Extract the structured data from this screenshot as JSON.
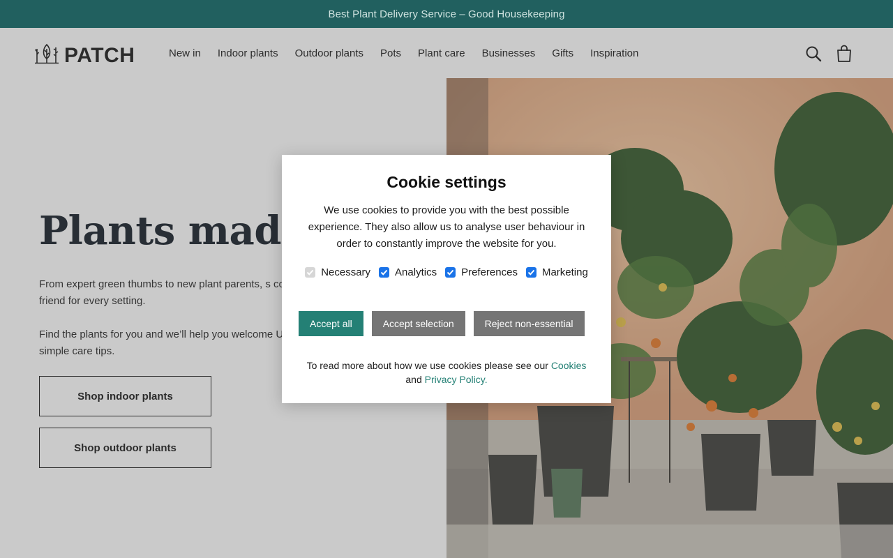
{
  "promo": {
    "text": "Best Plant Delivery Service – Good Housekeeping"
  },
  "brand": {
    "name": "PATCH"
  },
  "nav": [
    {
      "label": "New in"
    },
    {
      "label": "Indoor plants"
    },
    {
      "label": "Outdoor plants"
    },
    {
      "label": "Pots"
    },
    {
      "label": "Plant care"
    },
    {
      "label": "Businesses"
    },
    {
      "label": "Gifts"
    },
    {
      "label": "Inspiration"
    }
  ],
  "header_icons": [
    "search-icon",
    "bag-icon"
  ],
  "hero": {
    "title": "Plants made e",
    "p1": "From expert green thumbs to new plant parents, s corners, we have a leafy friend for every setting.",
    "p2": "Find the plants for you and we’ll help you welcome UK-wide delivery and simple care tips.",
    "btn_indoor": "Shop indoor plants",
    "btn_outdoor": "Shop outdoor plants"
  },
  "cookie": {
    "title": "Cookie settings",
    "text": "We use cookies to provide you with the best possible experience. They also allow us to analyse user behaviour in order to constantly improve the website for you.",
    "options": [
      {
        "label": "Necessary",
        "checked": true,
        "disabled": true
      },
      {
        "label": "Analytics",
        "checked": true
      },
      {
        "label": "Preferences",
        "checked": true
      },
      {
        "label": "Marketing",
        "checked": true
      }
    ],
    "accept_all": "Accept all",
    "accept_selection": "Accept selection",
    "reject": "Reject non-essential",
    "foot_prefix": "To read more about how we use cookies please see our",
    "cookies_link": "Cookies",
    "and": "and",
    "privacy_link": "Privacy Policy."
  },
  "colors": {
    "promo_bg": "#21605f",
    "accent": "#248075",
    "checkbox": "#1a73e8"
  }
}
